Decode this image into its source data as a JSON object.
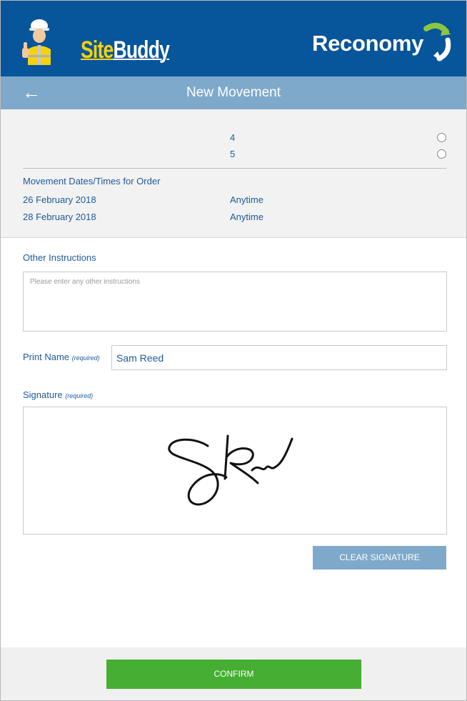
{
  "header": {
    "app_logo": {
      "part1": "Site",
      "part2": "Buddy"
    },
    "partner_logo": "Reconomy",
    "colors": {
      "header_bg": "#07559a",
      "titlebar_bg": "#7ea9cb",
      "accent_yellow": "#f5d10e",
      "confirm_green": "#46ae33"
    }
  },
  "titlebar": {
    "back_icon": "←",
    "title": "New Movement"
  },
  "options": [
    {
      "number": "4",
      "selected": false
    },
    {
      "number": "5",
      "selected": false
    }
  ],
  "movement": {
    "heading": "Movement Dates/Times for Order",
    "rows": [
      {
        "date": "26 February 2018",
        "time": "Anytime"
      },
      {
        "date": "28 February 2018",
        "time": "Anytime"
      }
    ]
  },
  "form": {
    "instructions_label": "Other Instructions",
    "instructions_placeholder": "Please enter any other instructions",
    "instructions_value": "",
    "print_name_label": "Print Name",
    "print_name_required": "(required)",
    "print_name_value": "Sam Reed",
    "signature_label": "Signature",
    "signature_required": "(required)",
    "clear_signature": "CLEAR SIGNATURE"
  },
  "footer": {
    "confirm": "CONFIRM"
  }
}
